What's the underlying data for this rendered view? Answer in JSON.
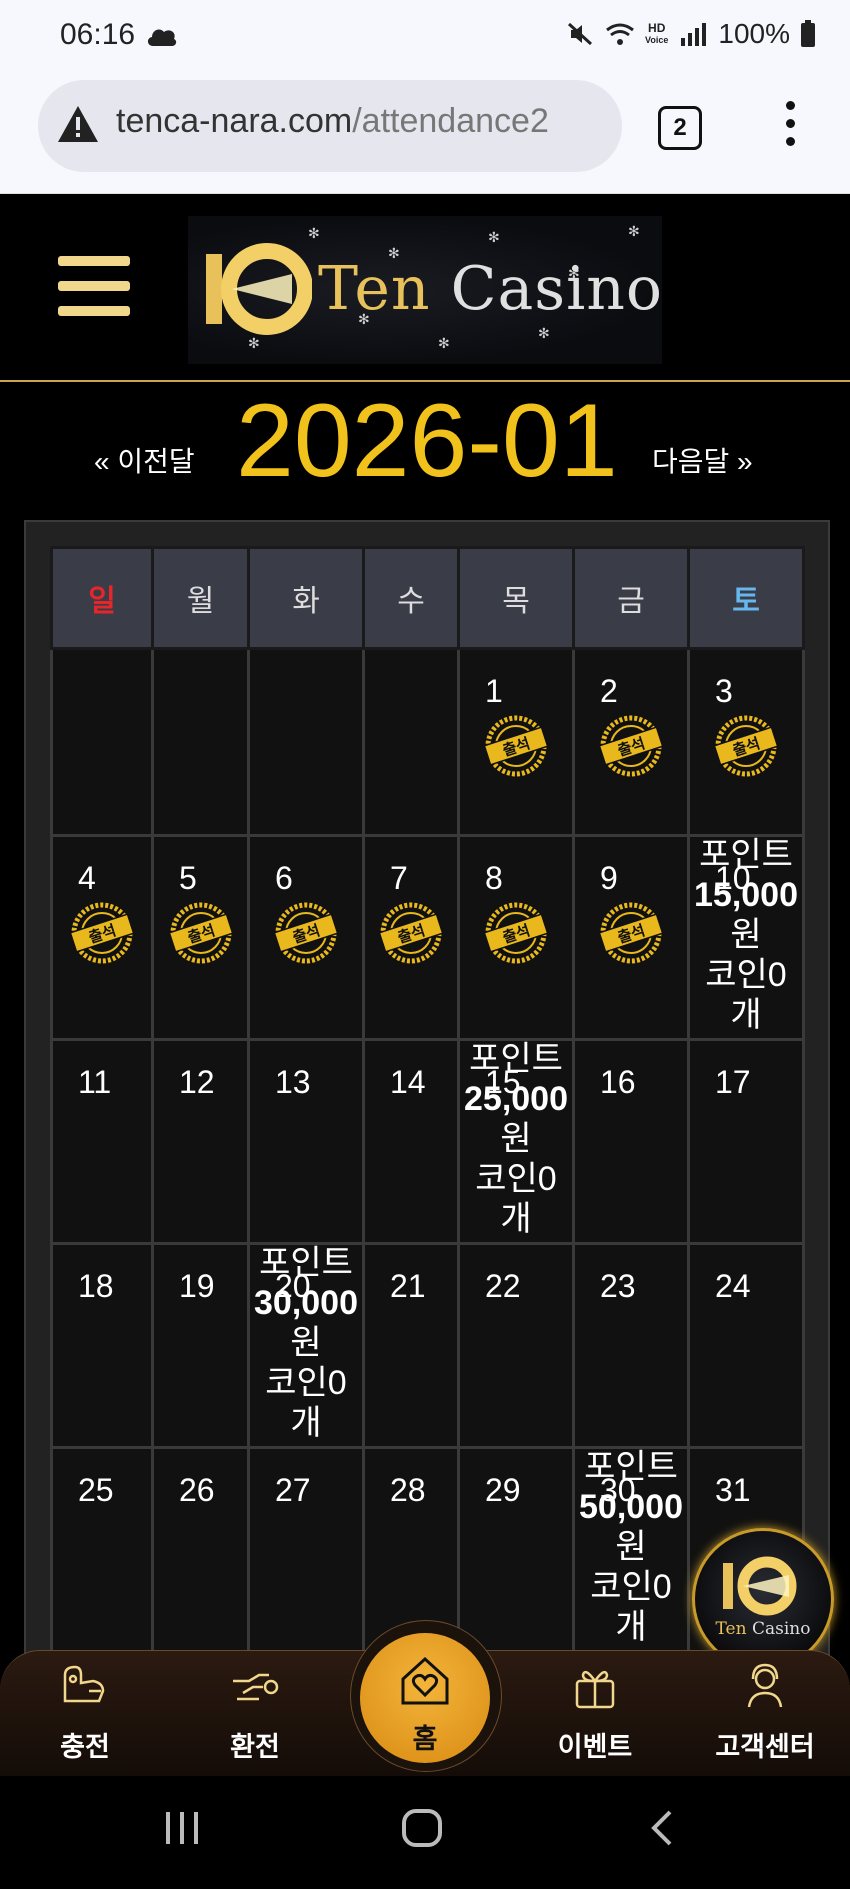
{
  "status_bar": {
    "time": "06:16",
    "battery": "100%",
    "hd_label": "HD",
    "voice_label": "Voice"
  },
  "browser": {
    "url_main": "tenca-nara.com",
    "url_path": "/attendance2",
    "tab_count": "2"
  },
  "site": {
    "logo_ten": "Ten",
    "logo_casino": "Casino"
  },
  "calendar": {
    "month_title": "2026-01",
    "prev_label": "« 이전달",
    "next_label": "다음달 »",
    "weekdays": [
      "일",
      "월",
      "화",
      "수",
      "목",
      "금",
      "토"
    ],
    "stamp_text": "출석",
    "weeks": [
      [
        {
          "day": ""
        },
        {
          "day": ""
        },
        {
          "day": ""
        },
        {
          "day": ""
        },
        {
          "day": "1",
          "stamp": true
        },
        {
          "day": "2",
          "stamp": true
        },
        {
          "day": "3",
          "stamp": true
        }
      ],
      [
        {
          "day": "4",
          "stamp": true
        },
        {
          "day": "5",
          "stamp": true
        },
        {
          "day": "6",
          "stamp": true
        },
        {
          "day": "7",
          "stamp": true
        },
        {
          "day": "8",
          "stamp": true
        },
        {
          "day": "9",
          "stamp": true
        },
        {
          "day": "10",
          "reward": {
            "label": "포인트",
            "amount": "15,000",
            "unit": "원",
            "coin": "코인0",
            "coin_unit": "개"
          }
        }
      ],
      [
        {
          "day": "11"
        },
        {
          "day": "12"
        },
        {
          "day": "13"
        },
        {
          "day": "14"
        },
        {
          "day": "15",
          "reward": {
            "label": "포인트",
            "amount": "25,000",
            "unit": "원",
            "coin": "코인0",
            "coin_unit": "개"
          }
        },
        {
          "day": "16"
        },
        {
          "day": "17"
        }
      ],
      [
        {
          "day": "18"
        },
        {
          "day": "19"
        },
        {
          "day": "20",
          "reward": {
            "label": "포인트",
            "amount": "30,000",
            "unit": "원",
            "coin": "코인0",
            "coin_unit": "개"
          }
        },
        {
          "day": "21"
        },
        {
          "day": "22"
        },
        {
          "day": "23"
        },
        {
          "day": "24"
        }
      ],
      [
        {
          "day": "25"
        },
        {
          "day": "26"
        },
        {
          "day": "27"
        },
        {
          "day": "28"
        },
        {
          "day": "29"
        },
        {
          "day": "30",
          "reward": {
            "label": "포인트",
            "amount": "50,000",
            "unit": "원",
            "coin": "코인0",
            "coin_unit": "개"
          }
        },
        {
          "day": "31"
        }
      ]
    ]
  },
  "floating_logo": {
    "ten": "Ten",
    "casino": "Casino"
  },
  "bottom_nav": {
    "charge": "충전",
    "exchange": "환전",
    "home": "홈",
    "event": "이벤트",
    "support": "고객센터"
  },
  "colors": {
    "accent_gold": "#f2c21c",
    "sunday": "#e5262b",
    "saturday": "#66b7ee",
    "home_button": "#e89d1f"
  }
}
